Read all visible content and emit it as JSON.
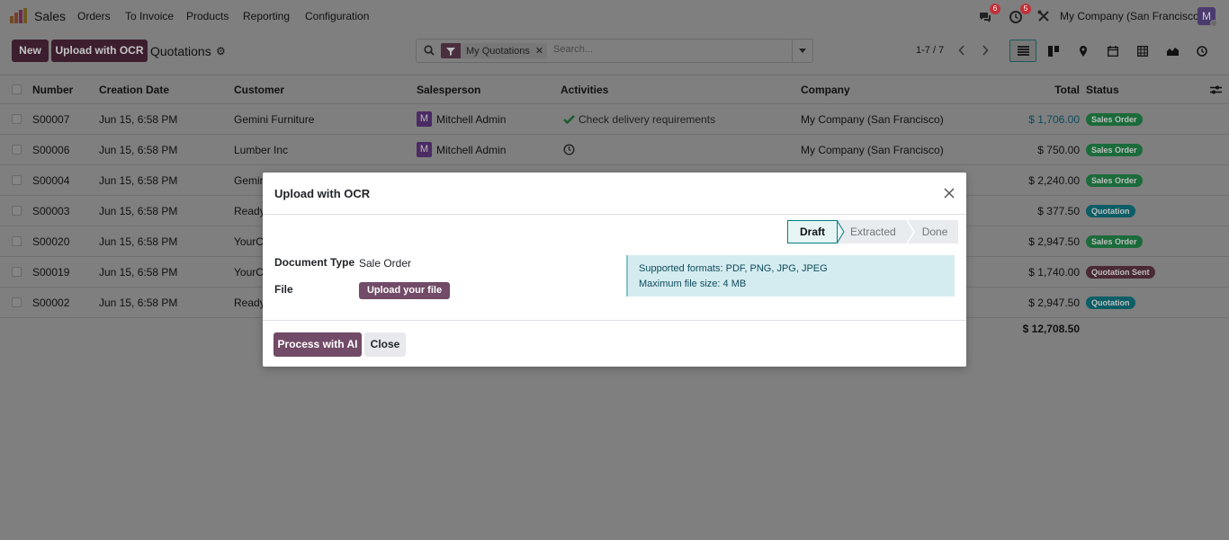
{
  "navbar": {
    "app_name": "Sales",
    "menu": [
      "Orders",
      "To Invoice",
      "Products",
      "Reporting",
      "Configuration"
    ],
    "chat_count": "6",
    "activity_count": "5",
    "company": "My Company (San Francisco)",
    "user_initial": "M"
  },
  "control": {
    "new_label": "New",
    "ocr_label": "Upload with OCR",
    "title": "Quotations",
    "facet": "My Quotations",
    "search_placeholder": "Search...",
    "pager": "1-7 / 7"
  },
  "list": {
    "columns": [
      "Number",
      "Creation Date",
      "Customer",
      "Salesperson",
      "Activities",
      "Company",
      "Total",
      "Status"
    ],
    "rows": [
      {
        "number": "S00007",
        "date": "Jun 15, 6:58 PM",
        "customer": "Gemini Furniture",
        "salesperson": "Mitchell Admin",
        "activity": "Check delivery requirements",
        "company": "My Company (San Francisco)",
        "total": "$ 1,706.00",
        "status": "Sales Order"
      },
      {
        "number": "S00006",
        "date": "Jun 15, 6:58 PM",
        "customer": "Lumber Inc",
        "salesperson": "Mitchell Admin",
        "activity": "",
        "company": "My Company (San Francisco)",
        "total": "$ 750.00",
        "status": "Sales Order"
      },
      {
        "number": "S00004",
        "date": "Jun 15, 6:58 PM",
        "customer": "Gemin",
        "salesperson": "",
        "activity": "",
        "company": "",
        "total": "$ 2,240.00",
        "status": "Sales Order"
      },
      {
        "number": "S00003",
        "date": "Jun 15, 6:58 PM",
        "customer": "Ready",
        "salesperson": "",
        "activity": "",
        "company": "",
        "total": "$ 377.50",
        "status": "Quotation"
      },
      {
        "number": "S00020",
        "date": "Jun 15, 6:58 PM",
        "customer": "YourC",
        "salesperson": "",
        "activity": "",
        "company": "",
        "total": "$ 2,947.50",
        "status": "Sales Order"
      },
      {
        "number": "S00019",
        "date": "Jun 15, 6:58 PM",
        "customer": "YourC",
        "salesperson": "",
        "activity": "",
        "company": "",
        "total": "$ 1,740.00",
        "status": "Quotation Sent"
      },
      {
        "number": "S00002",
        "date": "Jun 15, 6:58 PM",
        "customer": "Ready",
        "salesperson": "",
        "activity": "",
        "company": "",
        "total": "$ 2,947.50",
        "status": "Quotation"
      }
    ],
    "grand_total": "$ 12,708.50"
  },
  "modal": {
    "title": "Upload with OCR",
    "stages": [
      "Draft",
      "Extracted",
      "Done"
    ],
    "current_stage": "Draft",
    "document_type_label": "Document Type",
    "document_type_value": "Sale Order",
    "file_label": "File",
    "upload_label": "Upload your file",
    "info_line1": "Supported formats: PDF, PNG, JPG, JPEG",
    "info_line2": "Maximum file size: 4 MB",
    "process_label": "Process with AI",
    "close_label": "Close"
  },
  "colors": {
    "brand": "#714b67",
    "sales_order": "#1c6b3b",
    "quotation": "#0b5d66",
    "quotation_sent": "#4a2a35"
  }
}
